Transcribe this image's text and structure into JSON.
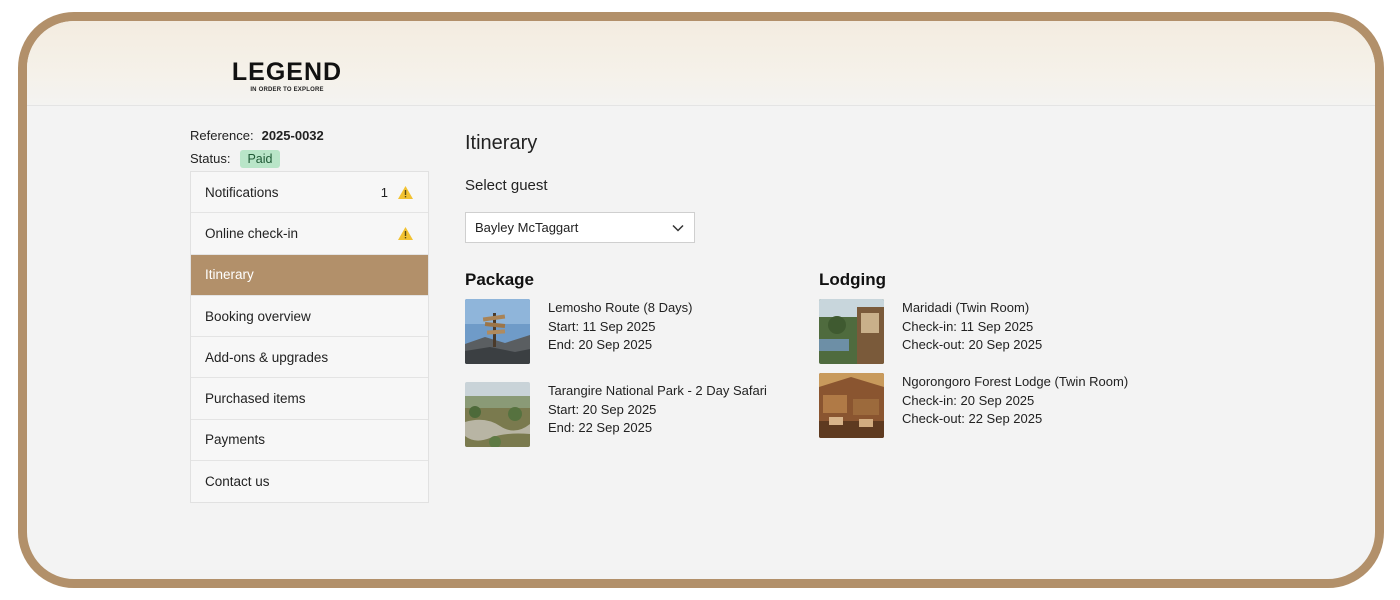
{
  "brand": {
    "name": "LEGEND",
    "tagline": "IN ORDER TO EXPLORE"
  },
  "booking": {
    "reference_label": "Reference:",
    "reference_value": "2025-0032",
    "status_label": "Status:",
    "status_value": "Paid",
    "status_color": "#b9e5c8"
  },
  "sidebar": {
    "items": [
      {
        "label": "Notifications",
        "count": "1",
        "icon": "warning-icon"
      },
      {
        "label": "Online check-in",
        "icon": "warning-icon"
      },
      {
        "label": "Itinerary",
        "active": true
      },
      {
        "label": "Booking overview"
      },
      {
        "label": "Add-ons & upgrades"
      },
      {
        "label": "Purchased items"
      },
      {
        "label": "Payments"
      },
      {
        "label": "Contact us"
      }
    ],
    "active_color": "#b2906a"
  },
  "main": {
    "title": "Itinerary",
    "select_guest_label": "Select guest",
    "selected_guest": "Bayley McTaggart",
    "package": {
      "title": "Package",
      "items": [
        {
          "name": "Lemosho Route (8 Days)",
          "line1": "Start: 11 Sep 2025",
          "line2": "End: 20 Sep 2025"
        },
        {
          "name": "Tarangire National Park - 2 Day Safari",
          "line1": "Start: 20 Sep 2025",
          "line2": "End: 22 Sep 2025"
        }
      ]
    },
    "lodging": {
      "title": "Lodging",
      "items": [
        {
          "name": "Maridadi (Twin Room)",
          "line1": "Check-in: 11 Sep 2025",
          "line2": "Check-out: 20 Sep 2025"
        },
        {
          "name": "Ngorongoro Forest Lodge (Twin Room)",
          "line1": "Check-in: 20 Sep 2025",
          "line2": "Check-out: 22 Sep 2025"
        }
      ]
    }
  },
  "colors": {
    "frame": "#b2906a",
    "warning": "#f2c232"
  }
}
